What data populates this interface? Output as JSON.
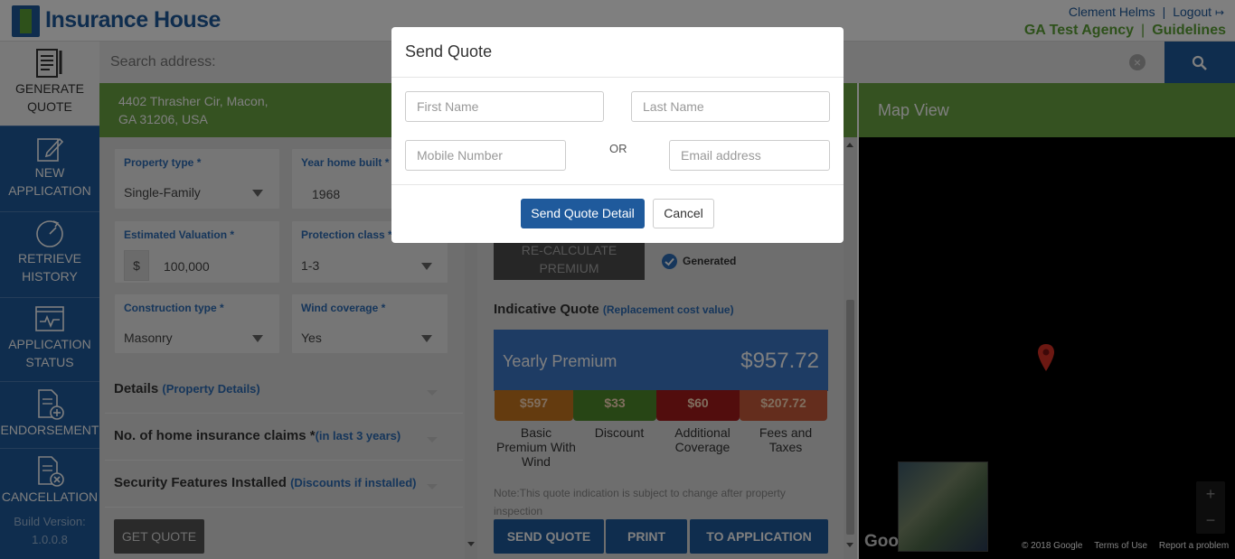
{
  "header": {
    "brand": "Insurance House",
    "user": "Clement Helms",
    "logout": "Logout",
    "agency": "GA Test Agency",
    "guidelines": "Guidelines"
  },
  "sidebar": {
    "items": [
      {
        "line1": "GENERATE",
        "line2": "QUOTE",
        "icon": "quote-doc-icon"
      },
      {
        "line1": "NEW",
        "line2": "APPLICATION",
        "icon": "pencil-icon"
      },
      {
        "line1": "RETRIEVE",
        "line2": "HISTORY",
        "icon": "history-icon"
      },
      {
        "line1": "APPLICATION",
        "line2": "STATUS",
        "icon": "status-monitor-icon"
      },
      {
        "line1": "ENDORSEMENT",
        "line2": "",
        "icon": "doc-plus-icon"
      },
      {
        "line1": "CANCELLATION",
        "line2": "",
        "icon": "doc-x-icon"
      }
    ],
    "build_label": "Build Version:",
    "build_version": "1.0.0.8"
  },
  "search": {
    "placeholder": "Search address:"
  },
  "address": {
    "line1": "4402 Thrasher Cir, Macon,",
    "line2": "GA 31206, USA"
  },
  "form": {
    "property_type_label": "Property type *",
    "property_type_value": "Single-Family",
    "year_built_label": "Year home built *",
    "year_built_value": "1968",
    "valuation_label": "Estimated Valuation *",
    "currency": "$",
    "valuation_value": "100,000",
    "protection_label": "Protection class *",
    "protection_value": "1-3",
    "construction_label": "Construction type *",
    "construction_value": "Masonry",
    "wind_label": "Wind coverage *",
    "wind_value": "Yes",
    "sections": [
      {
        "title": "Details",
        "sub": "(Property Details)"
      },
      {
        "title": "No. of home insurance claims *",
        "sub": "(in last 3 years)"
      },
      {
        "title": "Security Features Installed",
        "sub": "(Discounts if installed)"
      }
    ],
    "get_quote": "GET QUOTE"
  },
  "quote": {
    "recalc_line1": "RE-CALCULATE",
    "recalc_line2": "PREMIUM",
    "generated": "Generated",
    "title": "Indicative Quote",
    "subtitle": "(Replacement cost value)",
    "yearly_label": "Yearly Premium",
    "yearly_value": "$957.72",
    "tiles": [
      {
        "value": "$597",
        "cap1": "Basic",
        "cap2": "Premium With",
        "cap3": "Wind",
        "color": "#c8761f"
      },
      {
        "value": "$33",
        "cap1": "Discount",
        "cap2": "",
        "cap3": "",
        "color": "#4f8a2a"
      },
      {
        "value": "$60",
        "cap1": "Additional",
        "cap2": "Coverage",
        "cap3": "",
        "color": "#a51b1b"
      },
      {
        "value": "$207.72",
        "cap1": "Fees and",
        "cap2": "Taxes",
        "cap3": "",
        "color": "#c85a3a"
      }
    ],
    "note": "Note:This quote indication is subject to change after property inspection",
    "send_quote": "SEND QUOTE",
    "print": "PRINT",
    "to_application": "TO APPLICATION"
  },
  "map": {
    "title": "Map View",
    "google": "Goo",
    "copyright": "© 2018 Google",
    "terms": "Terms of Use",
    "report": "Report a problem",
    "zoom_in": "+",
    "zoom_out": "−"
  },
  "modal": {
    "title": "Send Quote",
    "first_name_ph": "First Name",
    "last_name_ph": "Last Name",
    "mobile_ph": "Mobile Number",
    "or": "OR",
    "email_ph": "Email address",
    "send_btn": "Send Quote Detail",
    "cancel_btn": "Cancel"
  }
}
